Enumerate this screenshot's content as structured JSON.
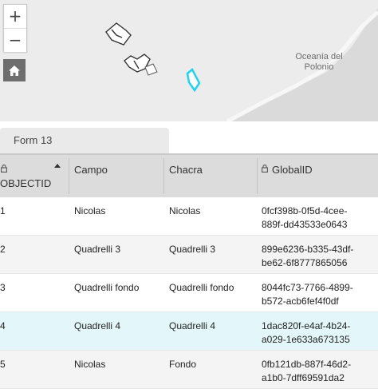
{
  "map": {
    "zoom_in_label": "+",
    "zoom_out_label": "−",
    "place_label_line1": "Oceanía del",
    "place_label_line2": "Polonio",
    "selected_feature_color": "#22d3ee",
    "feature_outline_color": "#333333",
    "land_color": "#ececec",
    "water_color": "#dadada"
  },
  "tabs": [
    {
      "label": "Form 13"
    }
  ],
  "table": {
    "columns": [
      {
        "label": "OBJECTID",
        "locked": true,
        "sorted": "asc"
      },
      {
        "label": "Campo",
        "locked": false
      },
      {
        "label": "Chacra",
        "locked": false
      },
      {
        "label": "GlobalID",
        "locked": true
      }
    ],
    "rows": [
      {
        "objectid": "1",
        "campo": "Nicolas",
        "chacra": "Nicolas",
        "globalid_line1": "0fcf398b-0f5d-4cee-",
        "globalid_line2": "889f-dd43533e0643",
        "selected": false
      },
      {
        "objectid": "2",
        "campo": "Quadrelli 3",
        "chacra": "Quadrelli 3",
        "globalid_line1": "899e6236-b335-43df-",
        "globalid_line2": "be62-6f8777865056",
        "selected": false
      },
      {
        "objectid": "3",
        "campo": "Quadrelli fondo",
        "chacra": "Quadrelli fondo",
        "globalid_line1": "8044fc73-7766-4899-",
        "globalid_line2": "b572-acb6fef4f0df",
        "selected": false
      },
      {
        "objectid": "4",
        "campo": "Quadrelli 4",
        "chacra": "Quadrelli 4",
        "globalid_line1": "1dac820f-e4af-4b24-",
        "globalid_line2": "a029-1e633a673135",
        "selected": true
      },
      {
        "objectid": "5",
        "campo": "Nicolas",
        "chacra": "Fondo",
        "globalid_line1": "0fb121db-887f-46d2-",
        "globalid_line2": "a1b0-7dff69591da2",
        "selected": false
      }
    ]
  }
}
